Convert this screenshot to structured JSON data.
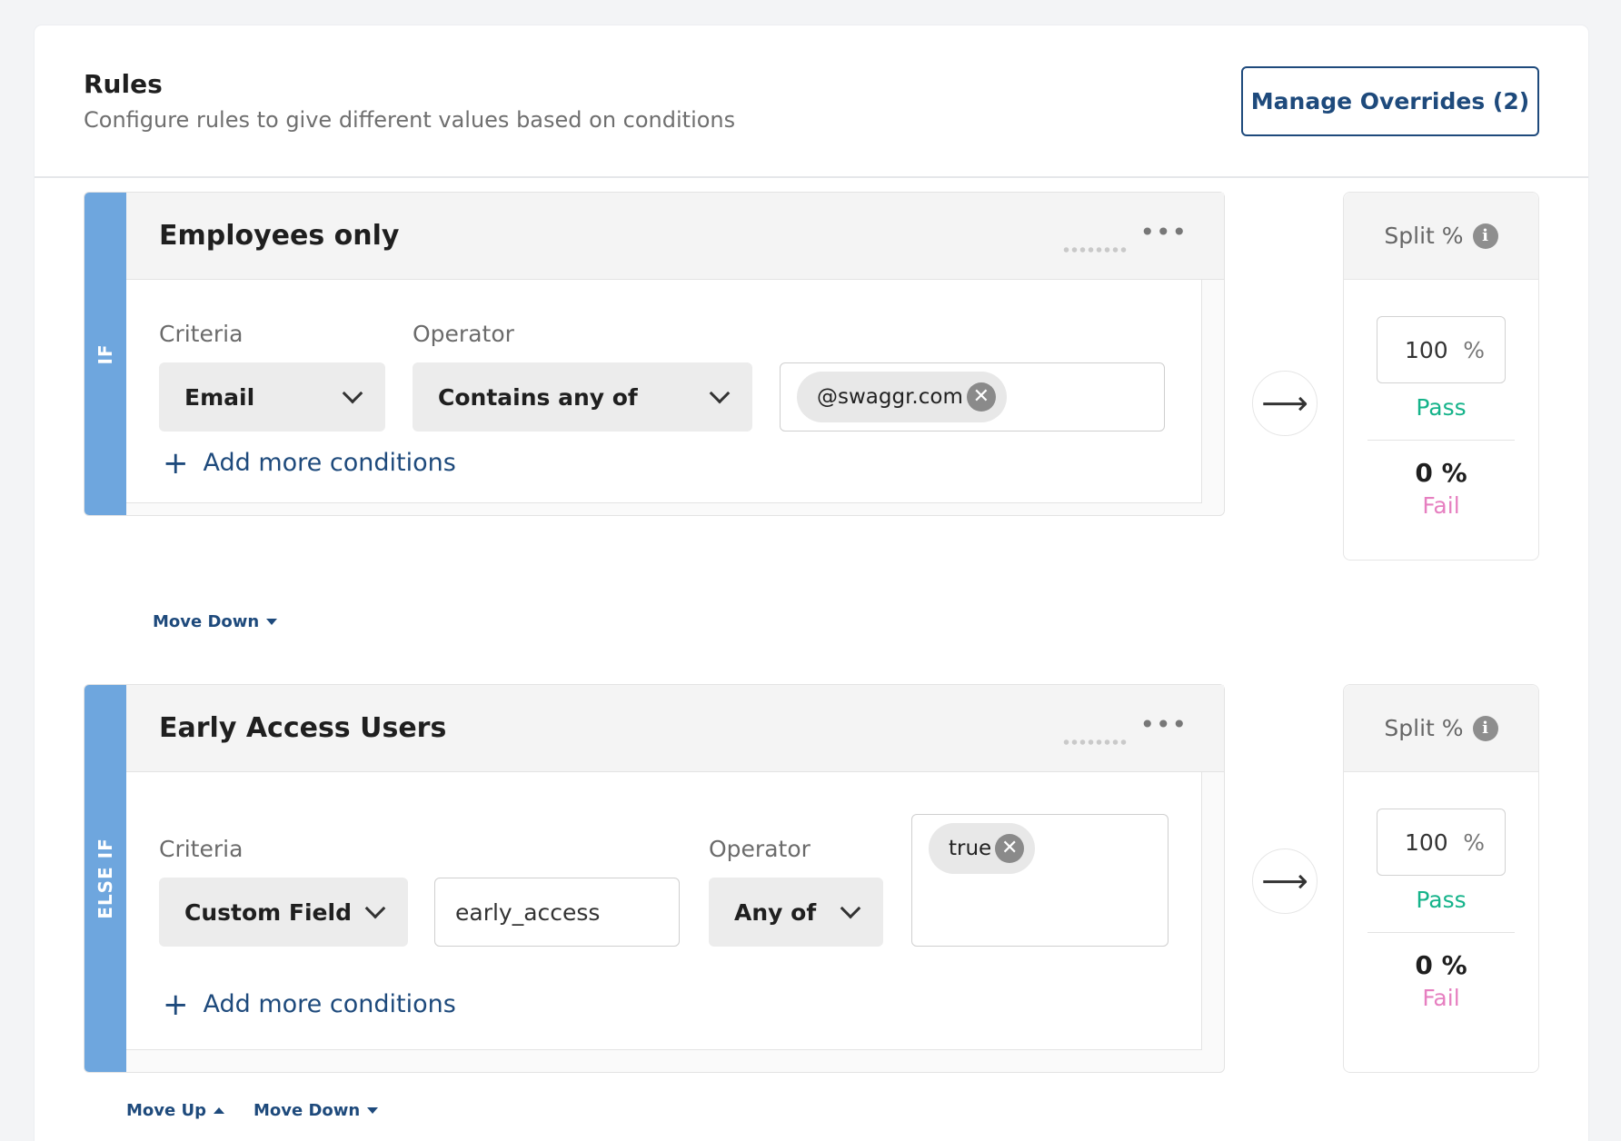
{
  "header": {
    "title": "Rules",
    "subtitle": "Configure rules to give different values based on conditions",
    "manage_overrides_label": "Manage Overrides (2)"
  },
  "rules": [
    {
      "tab_label": "IF",
      "name": "Employees only",
      "more_icon": "•••",
      "criteria_label": "Criteria",
      "operator_label": "Operator",
      "criteria_value": "Email",
      "operator_value": "Contains any of",
      "tag": "@swaggr.com",
      "add_more_label": "Add more conditions",
      "split": {
        "header": "Split %",
        "pass_value": "100",
        "unit": "%",
        "pass_label": "Pass",
        "fail_value": "0 %",
        "fail_label": "Fail"
      },
      "move_down_label": "Move Down"
    },
    {
      "tab_label": "ELSE IF",
      "name": "Early Access Users",
      "more_icon": "•••",
      "criteria_label": "Criteria",
      "operator_label": "Operator",
      "criteria_value": "Custom Field",
      "custom_field_value": "early_access",
      "operator_value": "Any of",
      "tag": "true",
      "add_more_label": "Add more conditions",
      "split": {
        "header": "Split %",
        "pass_value": "100",
        "unit": "%",
        "pass_label": "Pass",
        "fail_value": "0 %",
        "fail_label": "Fail"
      },
      "move_up_label": "Move Up",
      "move_down_label": "Move Down"
    }
  ],
  "icons": {
    "arrow": "⟶",
    "plus": "+",
    "close": "✕",
    "info": "i"
  },
  "colors": {
    "accent": "#1e4a7c",
    "rule_tab": "#6ea6de",
    "pass": "#15b38a",
    "fail": "#e67fc0"
  }
}
